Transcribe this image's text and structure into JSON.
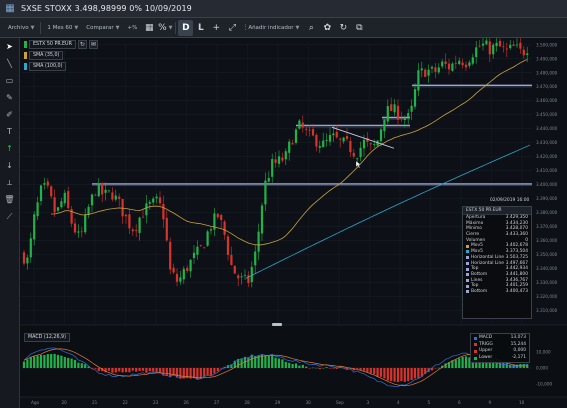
{
  "window": {
    "title": "SXSE STOXX 3.498,98999 0% 10/09/2019"
  },
  "toolbar": {
    "archivo": "Archivo",
    "period": "1 Mes 60",
    "compare": "Comparar",
    "plus": "+%",
    "letters": [
      "D",
      "L"
    ],
    "indicator": "Añadir indicador"
  },
  "legend": {
    "symbol": "ESTX 50 PR.EUR",
    "sma1": "SMA (35,0)",
    "sma2": "SMA (100,0)"
  },
  "colors": {
    "up": "#21b34a",
    "down": "#d9342b",
    "sma35": "#c9a23a",
    "sma100": "#2aa7c9",
    "hline": "#9aa6d8"
  },
  "price_axis": [
    "3.500,000",
    "3.490,000",
    "3.480,000",
    "3.470,000",
    "3.460,000",
    "3.450,000",
    "3.440,000",
    "3.430,000",
    "3.420,000",
    "3.410,000",
    "3.400,000",
    "3.390,000",
    "3.380,000",
    "3.370,000",
    "3.360,000",
    "3.350,000",
    "3.340,000",
    "3.330,000",
    "3.320,000",
    "3.310,000"
  ],
  "macd_axis": [
    "10,000",
    "0,000",
    "-10,000"
  ],
  "date_axis": [
    "Ago",
    "20",
    "21",
    "22",
    "23",
    "26",
    "27",
    "28",
    "29",
    "30",
    "Sep",
    "3",
    "4",
    "5",
    "6",
    "9",
    "10"
  ],
  "info": {
    "date": "02/09/2019 16:00",
    "head": "ESTX 50 PR.EUR",
    "rows": [
      {
        "label": "Apertura",
        "value": "3.429,350",
        "color": ""
      },
      {
        "label": "Máximo",
        "value": "3.434,230",
        "color": ""
      },
      {
        "label": "Mínimo",
        "value": "3.428,070",
        "color": ""
      },
      {
        "label": "Cierre",
        "value": "3.433,360",
        "color": ""
      },
      {
        "label": "Volumen",
        "value": "0",
        "color": ""
      },
      {
        "label": "Mov5",
        "value": "3.402,678",
        "color": "#c9a23a"
      },
      {
        "label": "Mov5",
        "value": "3.373,504",
        "color": "#2aa7c9"
      },
      {
        "label": "Horizontal Line",
        "value": "3.503,725",
        "color": "#9aa6d8"
      },
      {
        "label": "Horizontal Line",
        "value": "3.497,667",
        "color": "#9aa6d8"
      },
      {
        "label": "Top",
        "value": "3.442,934",
        "color": "#9aa6d8"
      },
      {
        "label": "Bottom",
        "value": "3.441,800",
        "color": "#9aa6d8"
      },
      {
        "label": "Lines",
        "value": "3.436,767",
        "color": "#9aa6d8"
      },
      {
        "label": "Top",
        "value": "3.401,259",
        "color": "#9aa6d8"
      },
      {
        "label": "Bottom",
        "value": "3.400,473",
        "color": "#9aa6d8"
      }
    ]
  },
  "macd": {
    "label": "MACD (12,26,9)",
    "rows": [
      {
        "label": "MACD",
        "value": "13,073",
        "color": "#2f6fd6"
      },
      {
        "label": "TRIGG",
        "value": "15,244",
        "color": "#d9342b"
      },
      {
        "label": "Upper",
        "value": "0,000",
        "color": "#d9342b"
      },
      {
        "label": "Lower",
        "value": "-2,171",
        "color": "#21b34a"
      }
    ]
  }
}
